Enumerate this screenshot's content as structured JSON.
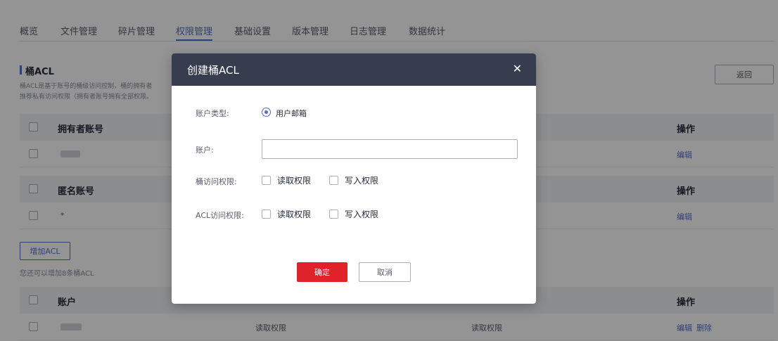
{
  "tabs": [
    "概览",
    "文件管理",
    "碎片管理",
    "权限管理",
    "基础设置",
    "版本管理",
    "日志管理",
    "数据统计"
  ],
  "section": {
    "title": "桶ACL",
    "desc_line1": "桶ACL是基于账号的桶级访问控制，桶的拥有者",
    "desc_line2": "推荐私有访问权限（拥有者账号拥有全部权限。"
  },
  "back_label": "返回",
  "owner_table": {
    "header": "拥有者账号",
    "action_header": "操作",
    "row_action": "编辑"
  },
  "anon_table": {
    "header": "匿名账号",
    "action_header": "操作",
    "row_value": "*",
    "row_action": "编辑"
  },
  "add_acl_label": "增加ACL",
  "add_hint": "您还可以增加8条桶ACL",
  "user_table": {
    "header": "账户",
    "action_header": "操作",
    "row_bucket_perm": "读取权限",
    "row_acl_perm": "读取权限",
    "row_edit": "编辑",
    "row_delete": "删除"
  },
  "dialog": {
    "title": "创建桶ACL",
    "close_icon": "close-icon",
    "account_type_label": "账户类型:",
    "account_type_option": "用户邮箱",
    "account_label": "账户:",
    "account_value": "",
    "bucket_perm_label": "桶访问权限:",
    "acl_perm_label": "ACL访问权限:",
    "read_label": "读取权限",
    "write_label": "写入权限",
    "confirm_label": "确定",
    "cancel_label": "取消"
  },
  "colors": {
    "accent": "#526ecc",
    "dialog_header": "#363d4f",
    "confirm": "#e0222a"
  }
}
